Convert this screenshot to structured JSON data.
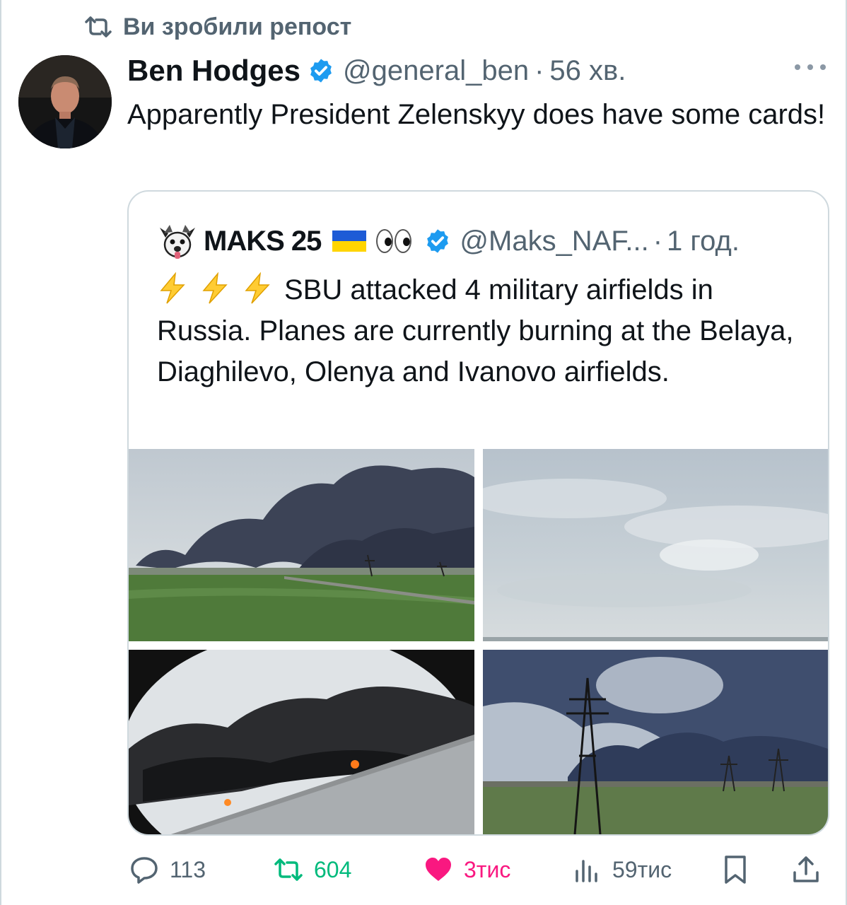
{
  "repost_banner": {
    "text": "Ви зробили репост",
    "icon": "repost-icon"
  },
  "tweet": {
    "author": {
      "name": "Ben Hodges",
      "handle": "@general_ben",
      "verified": true
    },
    "separator": "·",
    "time": "56 хв.",
    "text": "Apparently President Zelenskyy does have some cards!"
  },
  "quote": {
    "author": {
      "name": "MAKS 25",
      "handle": "@Maks_NAF...",
      "verified": true,
      "emoji": [
        "ukraine-flag",
        "eyes"
      ]
    },
    "separator": "·",
    "time": "1 год.",
    "text": "SBU attacked 4 military airfields in Russia. Planes are currently burning at the Belaya, Diaghilevo, Olenya and Ivanovo airfields.",
    "prefix_icons": [
      "lightning-icon",
      "lightning-icon",
      "lightning-icon"
    ],
    "media_count": 4
  },
  "actions": {
    "replies": "113",
    "reposts": "604",
    "likes": "3тис",
    "views": "59тис"
  },
  "colors": {
    "repost_green": "#00ba7c",
    "like_pink": "#f91880",
    "verified_blue": "#1d9bf0",
    "muted": "#536471"
  }
}
